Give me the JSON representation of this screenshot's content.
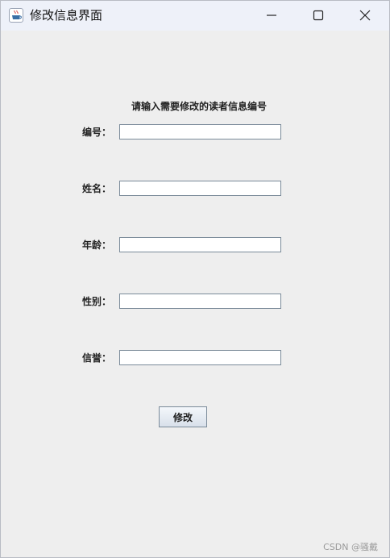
{
  "window": {
    "title": "修改信息界面"
  },
  "form": {
    "prompt": "请输入需要修改的读者信息编号",
    "fields": [
      {
        "label": "编号：",
        "value": ""
      },
      {
        "label": "姓名：",
        "value": ""
      },
      {
        "label": "年龄：",
        "value": ""
      },
      {
        "label": "性别：",
        "value": ""
      },
      {
        "label": "信誉：",
        "value": ""
      }
    ],
    "submit_label": "修改"
  },
  "watermark": "CSDN @骚戴",
  "icons": {
    "app": "java-cup-icon",
    "minimize": "minimize-icon",
    "maximize": "maximize-icon",
    "close": "close-icon"
  },
  "colors": {
    "titlebar": "#eef1f9",
    "window_bg": "#eeeeee",
    "input_border": "#7a8a99"
  }
}
